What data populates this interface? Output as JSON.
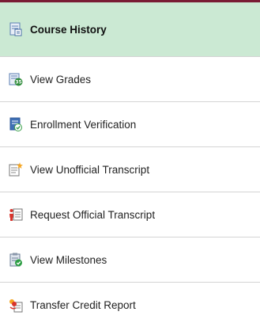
{
  "nav": {
    "items": [
      {
        "label": "Course History",
        "icon": "course-history-icon",
        "active": true
      },
      {
        "label": "View Grades",
        "icon": "grades-icon",
        "active": false
      },
      {
        "label": "Enrollment Verification",
        "icon": "enrollment-verification-icon",
        "active": false
      },
      {
        "label": "View Unofficial Transcript",
        "icon": "unofficial-transcript-icon",
        "active": false
      },
      {
        "label": "Request Official Transcript",
        "icon": "request-transcript-icon",
        "active": false
      },
      {
        "label": "View Milestones",
        "icon": "milestones-icon",
        "active": false
      },
      {
        "label": "Transfer Credit Report",
        "icon": "transfer-credit-icon",
        "active": false
      }
    ]
  },
  "colors": {
    "accent_top_border": "#7a1b34",
    "active_background": "#cbe9d3",
    "divider": "#d4d4d4"
  }
}
